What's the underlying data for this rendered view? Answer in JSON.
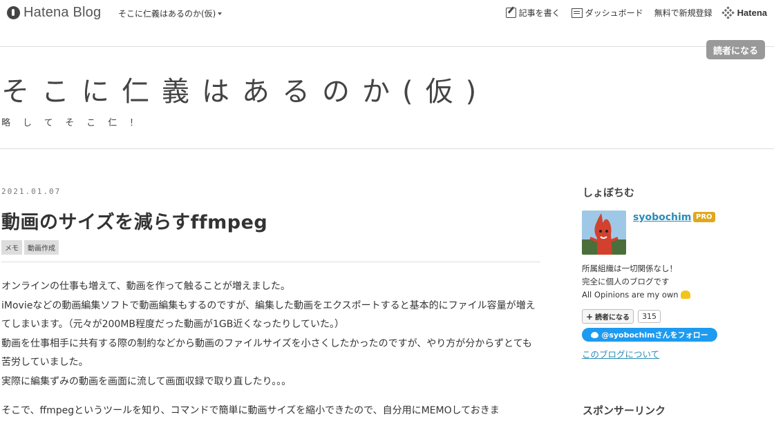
{
  "global_header": {
    "logo_text": "Hatena Blog",
    "blog_selector": "そこに仁義はあるのか(仮)",
    "nav": {
      "write": "記事を書く",
      "dashboard": "ダッシュボード",
      "signup": "無料で新規登録",
      "hatena": "Hatena"
    }
  },
  "subscribe_button": "読者になる",
  "blog": {
    "title": "そこに仁義はあるのか(仮)",
    "description": "略してそこ仁！"
  },
  "entry": {
    "date": "2021.01.07",
    "title": "動画のサイズを減らすffmpeg",
    "categories": [
      "メモ",
      "動画作成"
    ],
    "paragraphs": [
      "オンラインの仕事も増えて、動画を作って触ることが増えました。",
      "iMovieなどの動画編集ソフトで動画編集もするのですが、編集した動画をエクスポートすると基本的にファイル容量が増えてしまいます。（元々が200MB程度だった動画が1GB近くなったりしていた。）",
      "動画を仕事相手に共有する際の制約などから動画のファイルサイズを小さくしたかったのですが、やり方が分からずとても苦労していました。",
      "実際に編集ずみの動画を画面に流して画面収録で取り直したり。。。",
      "そこで、ffmpegというツールを知り、コマンドで簡単に動画サイズを縮小できたので、自分用にMEMOしておきま"
    ]
  },
  "sidebar": {
    "profile_heading": "しょぼちむ",
    "username": "syobochim",
    "badge": "PRO",
    "description": [
      "所属組織は一切関係なし！",
      "完全に個人のブログです",
      "All Opinions are my own"
    ],
    "reader_button": "読者になる",
    "reader_count": "315",
    "twitter_follow": "@syobochimさんをフォロー",
    "about_link": "このブログについて",
    "sponsor_heading": "スポンサーリンク"
  }
}
